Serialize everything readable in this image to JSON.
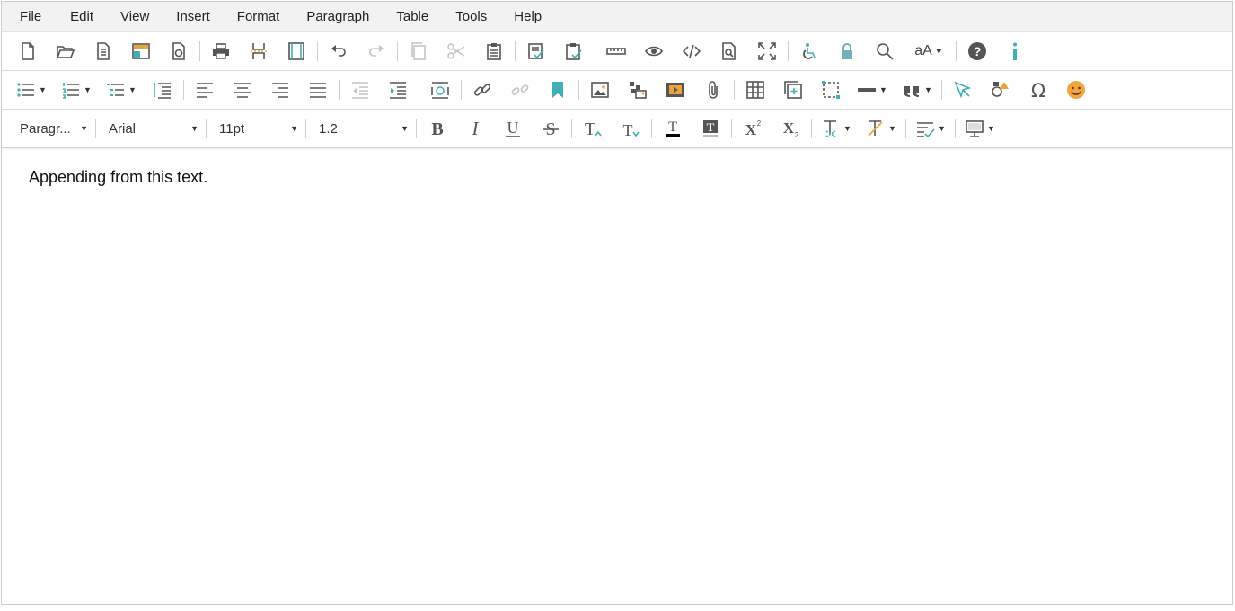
{
  "menu": [
    "File",
    "Edit",
    "View",
    "Insert",
    "Format",
    "Paragraph",
    "Table",
    "Tools",
    "Help"
  ],
  "toolbar": {
    "blocks_value": "Paragr...",
    "font_family_value": "Arial",
    "font_size_value": "11pt",
    "line_height_value": "1.2",
    "font_size_label": "aA"
  },
  "content": {
    "text": "Appending from this text."
  },
  "colors": {
    "accent": "#3fb0b3",
    "icon": "#555555",
    "emoji": "#f0a640",
    "lock": "#6fb3b8"
  }
}
